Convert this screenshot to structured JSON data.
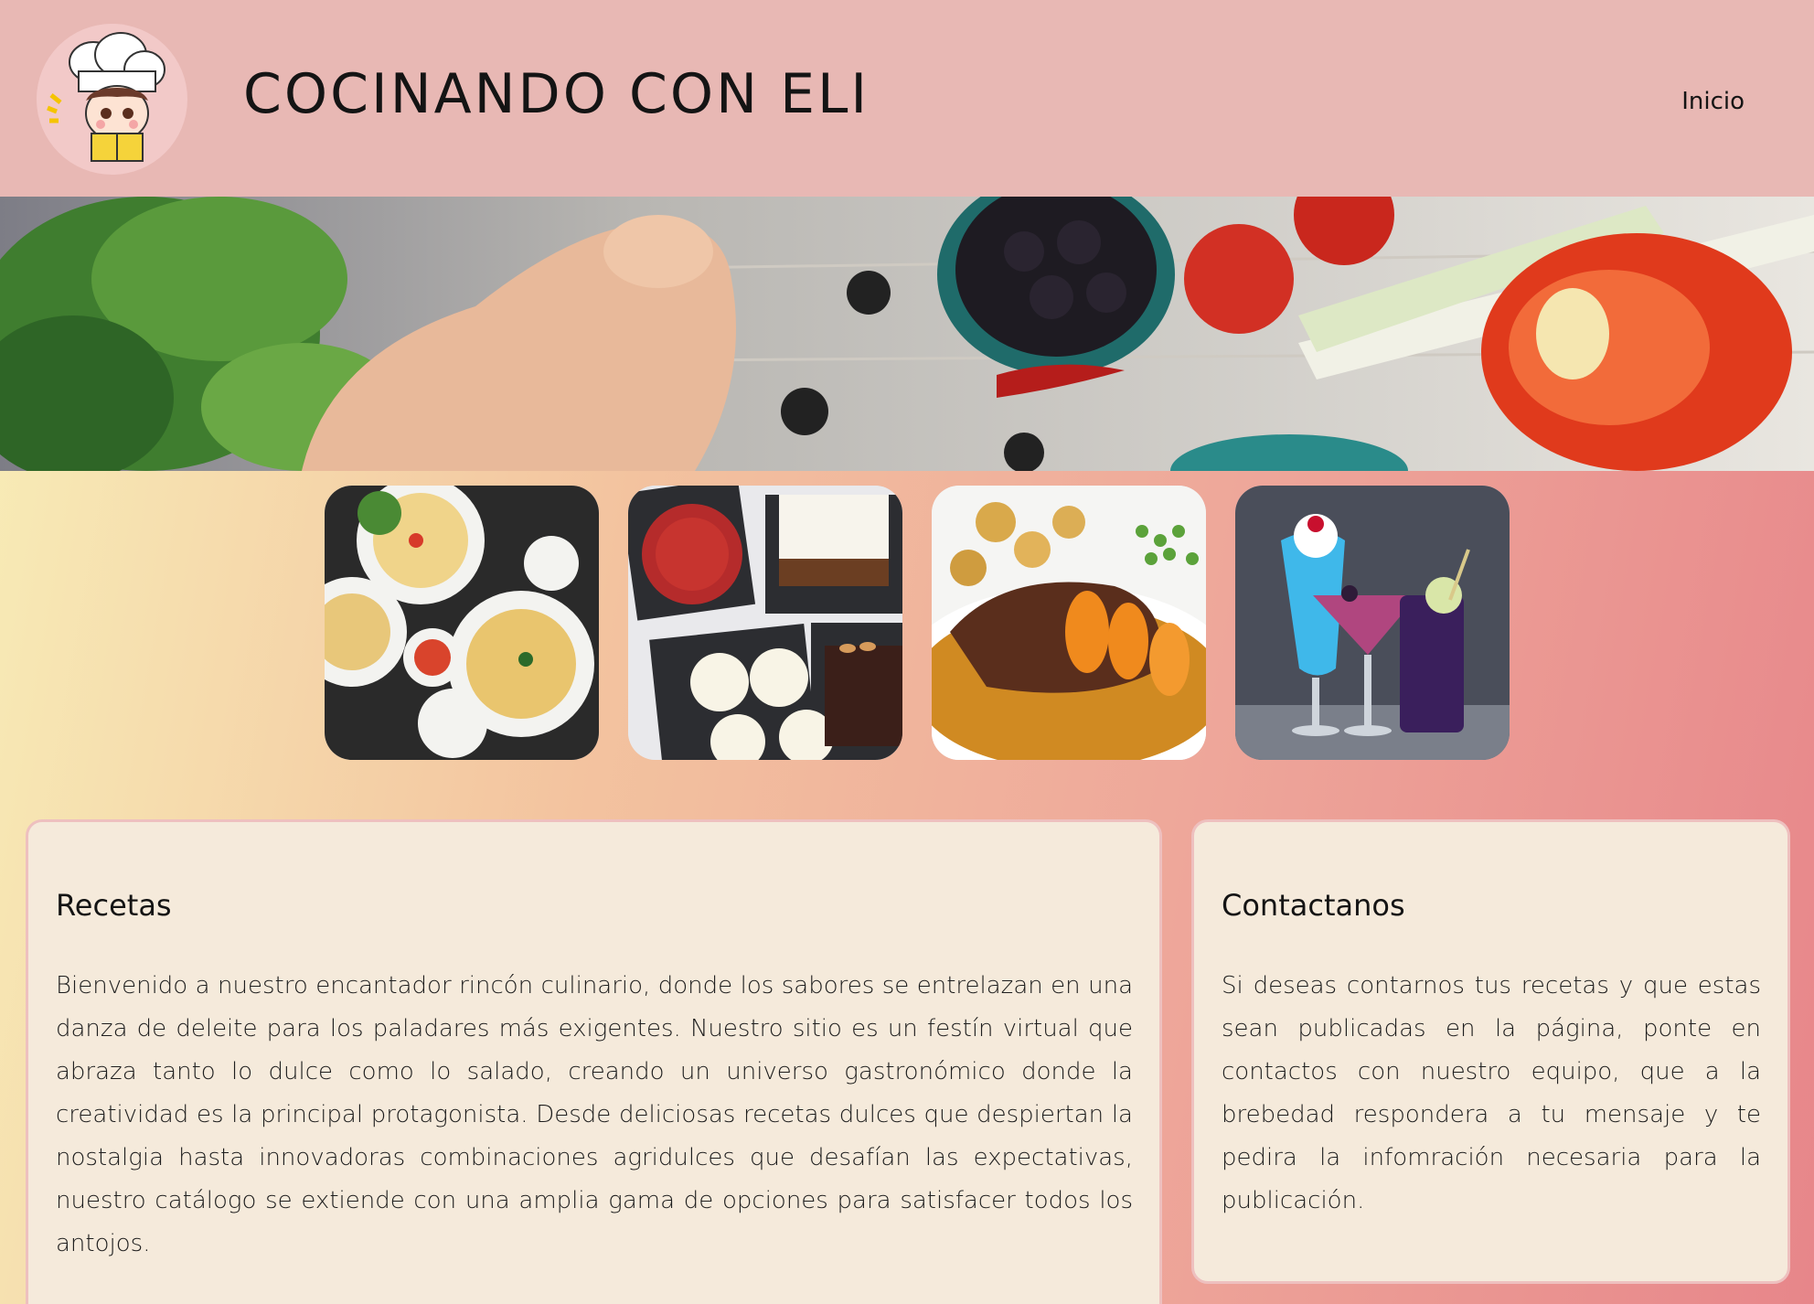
{
  "header": {
    "logo_icon": "chef-girl-logo-icon",
    "title": "COCINANDO CON ELI",
    "nav": {
      "home_label": "Inicio"
    }
  },
  "hero": {
    "image": "fresh-vegetables-banner-icon"
  },
  "gallery": [
    {
      "icon": "pasta-dishes-icon"
    },
    {
      "icon": "desserts-icon"
    },
    {
      "icon": "roast-dinner-icon"
    },
    {
      "icon": "cocktails-icon"
    }
  ],
  "recetas": {
    "title": "Recetas",
    "body": "Bienvenido a nuestro encantador rincón culinario, donde los sabores se entrelazan en una danza de deleite para los paladares más exigentes. Nuestro sitio es un festín virtual que abraza tanto lo dulce como lo salado, creando un universo gastronómico donde la creatividad es la principal protagonista. Desde deliciosas recetas dulces que despiertan la nostalgia hasta innovadoras combinaciones agridulces que desafían las expectativas, nuestro catálogo se extiende con una amplia gama de opciones para satisfacer todos los antojos."
  },
  "contactanos": {
    "title": "Contactanos",
    "body": "Si deseas contarnos tus recetas y que estas sean publicadas en la página, ponte en contactos con nuestro equipo, que a la brebedad respondera a tu mensaje y te pedira la infomración necesaria para la publicación."
  },
  "colors": {
    "header_bg": "#e8b8b4",
    "card_bg": "#f5eadb",
    "card_border": "#eec0bf",
    "gradient_start": "#f8efb8",
    "gradient_end": "#e7868a"
  }
}
